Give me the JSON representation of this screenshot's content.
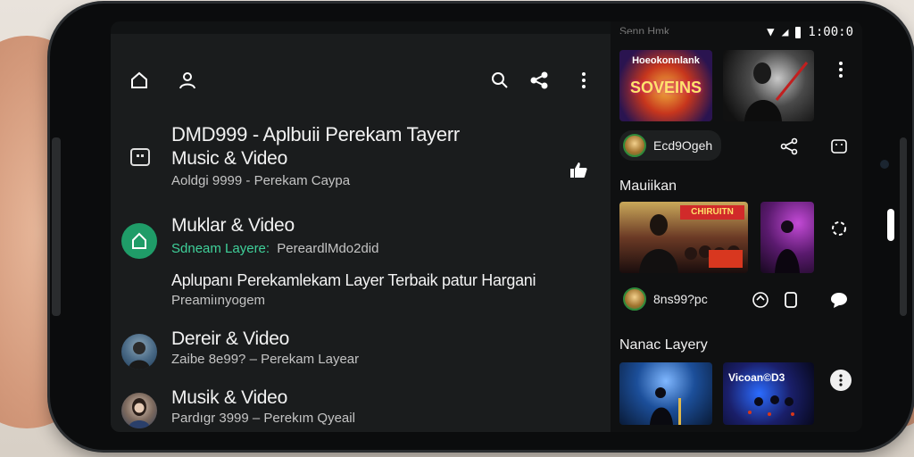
{
  "status": {
    "time": "1:00:0"
  },
  "main": {
    "header_title": "DMD999 - Aplbuii Perekam Tayerr",
    "header_subtitle": "Music & Video",
    "header_caption": "Aoldgi 9999 - Perekam Caypa",
    "rows": [
      {
        "title": "Muklar & Video",
        "sub": "Sdneam Layere:",
        "sub2": "PereardlMdo2did"
      },
      {
        "title": "Aplupanı Perekamlekam Layer Terbaik patur Hargani",
        "sub": "Preamiınyogem"
      },
      {
        "title": "Dereir & Video",
        "sub": "Zaibe 8e99? – Perekam Layear"
      },
      {
        "title": "Musik & Video",
        "sub": "Pardıgr 3999 – Perekım Qyeail"
      }
    ]
  },
  "right": {
    "header_partial": "Senn Hmk",
    "banner_text": "Hoeokonnlank",
    "banner_big": "SOVEINS",
    "chip1": "Ecd9Ogeh",
    "section1": "Mauiikan",
    "poster_text": "CHIRUITN",
    "chip2": "8ns99?pc",
    "section2": "Nanac Layery",
    "thumb_label": "Vicoan©D3"
  }
}
